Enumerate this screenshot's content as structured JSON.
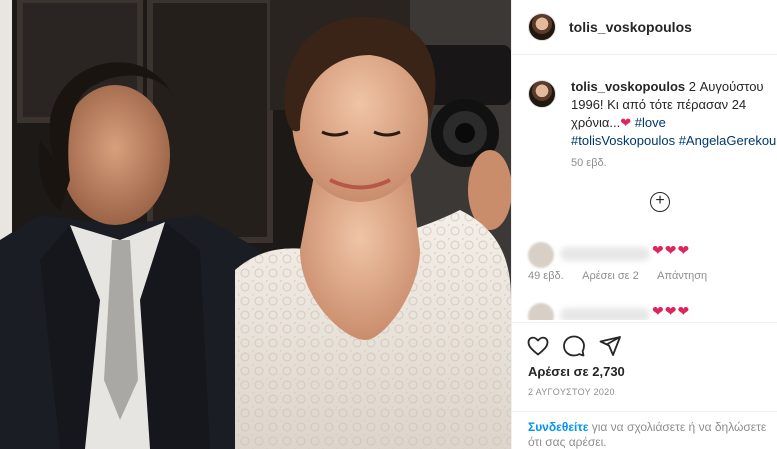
{
  "post": {
    "username": "tolis_voskopoulos"
  },
  "caption": {
    "username": "tolis_voskopoulos",
    "text_line1": "2 Αυγούστου",
    "text_line2": "1996! Κι από τότε πέρασαν 24",
    "text_line3": "χρόνια...",
    "heart": "❤",
    "tag_love": "#love",
    "tag_tolis": "#tolisVoskopoulos",
    "tag_angela": "#AngelaGerekou",
    "age": "50 εβδ."
  },
  "comments": [
    {
      "hearts": "❤❤❤",
      "age": "49 εβδ.",
      "likes": "Αρέσει σε 2",
      "reply": "Απάντηση"
    },
    {
      "hearts": "❤❤❤"
    }
  ],
  "actions": {
    "likes": "Αρέσει σε 2,730",
    "date": "2 ΑΥΓΟΥΣΤΟΥ 2020"
  },
  "login": {
    "link": "Συνδεθείτε",
    "text_line1_rest": " για να σχολιάσετε ή να δηλώσετε",
    "text_line2": "ότι σας αρέσει."
  },
  "colors": {
    "heart": "#e0245e",
    "link": "#0095f6",
    "hashtag": "#00376b",
    "secondary_text": "#8e8e8e"
  }
}
